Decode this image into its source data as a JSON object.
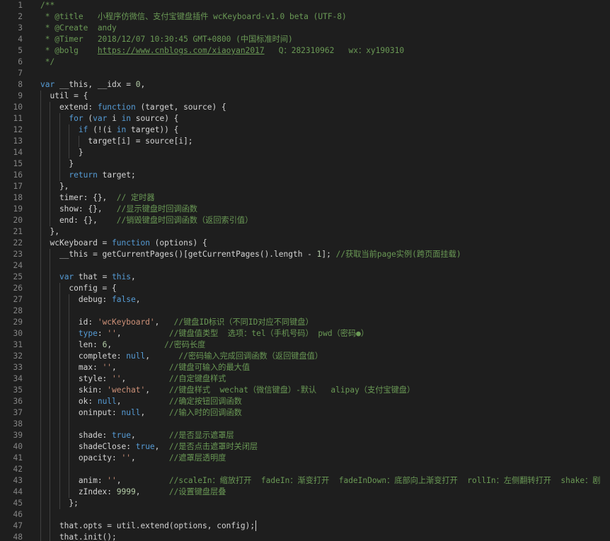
{
  "editor": {
    "lines": [
      {
        "n": "1",
        "i": 0,
        "t": [
          [
            "c",
            "/**"
          ]
        ]
      },
      {
        "n": "2",
        "i": 0,
        "t": [
          [
            "c",
            " * @title   小程序仿微信、支付宝键盘插件 wcKeyboard-v1.0 beta (UTF-8)"
          ]
        ]
      },
      {
        "n": "3",
        "i": 0,
        "t": [
          [
            "c",
            " * @Create  andy"
          ]
        ]
      },
      {
        "n": "4",
        "i": 0,
        "t": [
          [
            "c",
            " * @Timer   2018/12/07 10:30:45 GMT+0800 (中国标准时间)"
          ]
        ]
      },
      {
        "n": "5",
        "i": 0,
        "t": [
          [
            "c",
            " * @bolg    "
          ],
          [
            "l",
            "https://www.cnblogs.com/xiaoyan2017"
          ],
          [
            "c",
            "   Q：282310962   wx：xy190310"
          ]
        ]
      },
      {
        "n": "6",
        "i": 0,
        "t": [
          [
            "c",
            " */"
          ]
        ]
      },
      {
        "n": "7",
        "i": 0,
        "t": []
      },
      {
        "n": "8",
        "i": 0,
        "t": [
          [
            "k",
            "var"
          ],
          [
            "p",
            " __this, __idx = "
          ],
          [
            "n",
            "0"
          ],
          [
            "p",
            ","
          ]
        ]
      },
      {
        "n": "9",
        "i": 1,
        "t": [
          [
            "p",
            "  util = {"
          ]
        ]
      },
      {
        "n": "10",
        "i": 2,
        "t": [
          [
            "p",
            "    extend: "
          ],
          [
            "k",
            "function"
          ],
          [
            "p",
            " (target, source) {"
          ]
        ]
      },
      {
        "n": "11",
        "i": 3,
        "t": [
          [
            "p",
            "      "
          ],
          [
            "k",
            "for"
          ],
          [
            "p",
            " ("
          ],
          [
            "k",
            "var"
          ],
          [
            "p",
            " i "
          ],
          [
            "k",
            "in"
          ],
          [
            "p",
            " source) {"
          ]
        ]
      },
      {
        "n": "12",
        "i": 4,
        "t": [
          [
            "p",
            "        "
          ],
          [
            "k",
            "if"
          ],
          [
            "p",
            " (!(i "
          ],
          [
            "k",
            "in"
          ],
          [
            "p",
            " target)) {"
          ]
        ]
      },
      {
        "n": "13",
        "i": 5,
        "t": [
          [
            "p",
            "          target[i] = source[i];"
          ]
        ]
      },
      {
        "n": "14",
        "i": 4,
        "t": [
          [
            "p",
            "        }"
          ]
        ]
      },
      {
        "n": "15",
        "i": 3,
        "t": [
          [
            "p",
            "      }"
          ]
        ]
      },
      {
        "n": "16",
        "i": 3,
        "t": [
          [
            "p",
            "      "
          ],
          [
            "k",
            "return"
          ],
          [
            "p",
            " target;"
          ]
        ]
      },
      {
        "n": "17",
        "i": 2,
        "t": [
          [
            "p",
            "    },"
          ]
        ]
      },
      {
        "n": "18",
        "i": 2,
        "t": [
          [
            "p",
            "    timer: {},  "
          ],
          [
            "c",
            "// 定时器"
          ]
        ]
      },
      {
        "n": "19",
        "i": 2,
        "t": [
          [
            "p",
            "    show: {},   "
          ],
          [
            "c",
            "//显示键盘时回调函数"
          ]
        ]
      },
      {
        "n": "20",
        "i": 2,
        "t": [
          [
            "p",
            "    end: {},    "
          ],
          [
            "c",
            "//销毁键盘时回调函数（返回索引值）"
          ]
        ]
      },
      {
        "n": "21",
        "i": 1,
        "t": [
          [
            "p",
            "  },"
          ]
        ]
      },
      {
        "n": "22",
        "i": 1,
        "t": [
          [
            "p",
            "  wcKeyboard = "
          ],
          [
            "k",
            "function"
          ],
          [
            "p",
            " (options) {"
          ]
        ]
      },
      {
        "n": "23",
        "i": 2,
        "t": [
          [
            "p",
            "    __this = getCurrentPages()[getCurrentPages().length - "
          ],
          [
            "n",
            "1"
          ],
          [
            "p",
            "]; "
          ],
          [
            "c",
            "//获取当前page实例(跨页面挂载)"
          ]
        ]
      },
      {
        "n": "24",
        "i": 2,
        "t": []
      },
      {
        "n": "25",
        "i": 2,
        "t": [
          [
            "p",
            "    "
          ],
          [
            "k",
            "var"
          ],
          [
            "p",
            " that = "
          ],
          [
            "k",
            "this"
          ],
          [
            "p",
            ","
          ]
        ]
      },
      {
        "n": "26",
        "i": 3,
        "t": [
          [
            "p",
            "      config = {"
          ]
        ]
      },
      {
        "n": "27",
        "i": 4,
        "t": [
          [
            "p",
            "        debug: "
          ],
          [
            "k",
            "false"
          ],
          [
            "p",
            ","
          ]
        ]
      },
      {
        "n": "28",
        "i": 4,
        "t": []
      },
      {
        "n": "29",
        "i": 4,
        "t": [
          [
            "p",
            "        id: "
          ],
          [
            "s",
            "'wcKeyboard'"
          ],
          [
            "p",
            ",   "
          ],
          [
            "c",
            "//键盘ID标识（不同ID对应不同键盘）"
          ]
        ]
      },
      {
        "n": "30",
        "i": 4,
        "t": [
          [
            "p",
            "        "
          ],
          [
            "k",
            "type"
          ],
          [
            "p",
            ": "
          ],
          [
            "s",
            "''"
          ],
          [
            "p",
            ",          "
          ],
          [
            "c",
            "//键盘值类型  选项：tel（手机号码） pwd（密码●）"
          ]
        ]
      },
      {
        "n": "31",
        "i": 4,
        "t": [
          [
            "p",
            "        len: "
          ],
          [
            "n",
            "6"
          ],
          [
            "p",
            ",           "
          ],
          [
            "c",
            "//密码长度"
          ]
        ]
      },
      {
        "n": "32",
        "i": 4,
        "t": [
          [
            "p",
            "        complete: "
          ],
          [
            "k",
            "null"
          ],
          [
            "p",
            ",      "
          ],
          [
            "c",
            "//密码输入完成回调函数（返回键盘值）"
          ]
        ]
      },
      {
        "n": "33",
        "i": 4,
        "t": [
          [
            "p",
            "        max: "
          ],
          [
            "s",
            "''"
          ],
          [
            "p",
            ",           "
          ],
          [
            "c",
            "//键盘可输入的最大值"
          ]
        ]
      },
      {
        "n": "34",
        "i": 4,
        "t": [
          [
            "p",
            "        style: "
          ],
          [
            "s",
            "''"
          ],
          [
            "p",
            ",         "
          ],
          [
            "c",
            "//自定键盘样式"
          ]
        ]
      },
      {
        "n": "35",
        "i": 4,
        "t": [
          [
            "p",
            "        skin: "
          ],
          [
            "s",
            "'wechat'"
          ],
          [
            "p",
            ",    "
          ],
          [
            "c",
            "//键盘样式  wechat（微信键盘）-默认   alipay（支付宝键盘）"
          ]
        ]
      },
      {
        "n": "36",
        "i": 4,
        "t": [
          [
            "p",
            "        ok: "
          ],
          [
            "k",
            "null"
          ],
          [
            "p",
            ",          "
          ],
          [
            "c",
            "//确定按钮回调函数"
          ]
        ]
      },
      {
        "n": "37",
        "i": 4,
        "t": [
          [
            "p",
            "        oninput: "
          ],
          [
            "k",
            "null"
          ],
          [
            "p",
            ",     "
          ],
          [
            "c",
            "//输入时的回调函数"
          ]
        ]
      },
      {
        "n": "38",
        "i": 4,
        "t": []
      },
      {
        "n": "39",
        "i": 4,
        "t": [
          [
            "p",
            "        shade: "
          ],
          [
            "k",
            "true"
          ],
          [
            "p",
            ",       "
          ],
          [
            "c",
            "//是否显示遮罩层"
          ]
        ]
      },
      {
        "n": "40",
        "i": 4,
        "t": [
          [
            "p",
            "        shadeClose: "
          ],
          [
            "k",
            "true"
          ],
          [
            "p",
            ",  "
          ],
          [
            "c",
            "//是否点击遮罩时关闭层"
          ]
        ]
      },
      {
        "n": "41",
        "i": 4,
        "t": [
          [
            "p",
            "        opacity: "
          ],
          [
            "s",
            "''"
          ],
          [
            "p",
            ",       "
          ],
          [
            "c",
            "//遮罩层透明度"
          ]
        ]
      },
      {
        "n": "42",
        "i": 4,
        "t": []
      },
      {
        "n": "43",
        "i": 4,
        "t": [
          [
            "p",
            "        anim: "
          ],
          [
            "s",
            "''"
          ],
          [
            "p",
            ",          "
          ],
          [
            "c",
            "//scaleIn：缩放打开  fadeIn：渐变打开  fadeInDown：底部向上渐变打开  rollIn：左侧翻转打开  shake：剧"
          ]
        ]
      },
      {
        "n": "44",
        "i": 4,
        "t": [
          [
            "p",
            "        zIndex: "
          ],
          [
            "n",
            "9999"
          ],
          [
            "p",
            ",      "
          ],
          [
            "c",
            "//设置键盘层叠"
          ]
        ]
      },
      {
        "n": "45",
        "i": 3,
        "t": [
          [
            "p",
            "      };"
          ]
        ]
      },
      {
        "n": "46",
        "i": 2,
        "t": []
      },
      {
        "n": "47",
        "i": 2,
        "t": [
          [
            "p",
            "    that.opts = util.extend(options, config);"
          ]
        ]
      },
      {
        "n": "48",
        "i": 2,
        "t": [
          [
            "p",
            "    that.init();"
          ]
        ]
      }
    ]
  }
}
